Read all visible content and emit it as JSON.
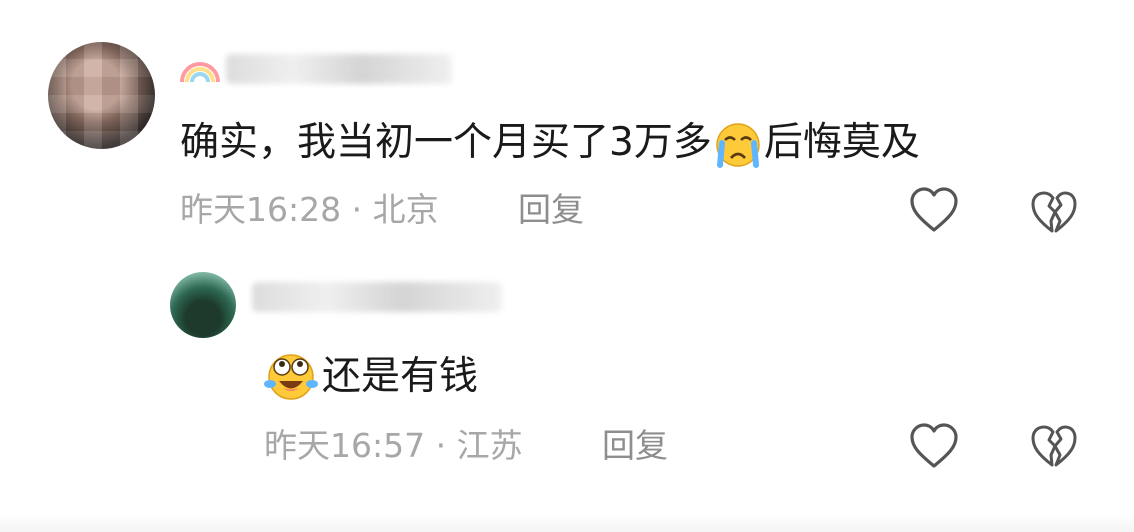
{
  "comments": [
    {
      "username": "",
      "text": "确实，我当初一个月买了3万多",
      "text_after_emoji": "后悔莫及",
      "emoji_icon": "crying-face",
      "time": "昨天16:28",
      "location": "北京",
      "separator": " · ",
      "reply_label": "回复"
    },
    {
      "username": "",
      "emoji_icon": "laughing-tears-face",
      "text": "还是有钱",
      "time": "昨天16:57",
      "location": "江苏",
      "separator": " · ",
      "reply_label": "回复"
    }
  ],
  "icons": {
    "like": "heart-outline-icon",
    "dislike": "broken-heart-icon"
  },
  "colors": {
    "text": "#1a1a1a",
    "meta": "#a7a7a7",
    "icon": "#555555"
  }
}
